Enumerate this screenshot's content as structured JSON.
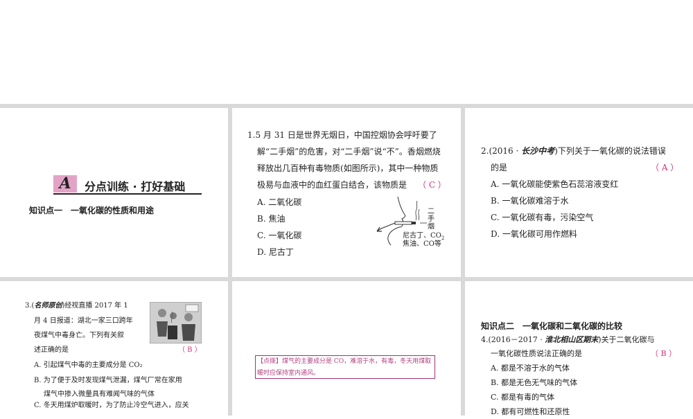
{
  "section": {
    "badge": "A",
    "title": "分点训练 · 打好基础",
    "kp1": "知识点一　一氧化碳的性质和用途",
    "kp2": "知识点二　一氧化碳和二氧化碳的比较"
  },
  "q1": {
    "lines": [
      "1.5 月 31 日是世界无烟日，中国控烟协会呼吁要了",
      "解“二手烟”的危害，对“二手烟”说“不”。香烟燃烧",
      "释放出几百种有毒物质(如图所示)，其中一种物质",
      "极易与血液中的血红蛋白结合，该物质是"
    ],
    "answer": "（ C ）",
    "options": [
      "A. 二氧化碳",
      "B. 焦油",
      "C. 一氧化碳",
      "D. 尼古丁"
    ],
    "figure_labels": {
      "vertical": [
        "二",
        "手",
        "烟"
      ],
      "line1": "尼古丁、CO",
      "sub": "2",
      "line2": "焦油、CO等"
    }
  },
  "q2": {
    "stem_prefix": "2.(2016 · ",
    "source": "长沙中考",
    "stem_suffix": ")下列关于一氧化碳的说法错误",
    "line2": "的是",
    "answer": "（ A ）",
    "options": [
      "A. 一氧化碳能使紫色石蕊溶液变红",
      "B. 一氧化碳难溶于水",
      "C. 一氧化碳有毒，污染空气",
      "D. 一氧化碳可用作燃料"
    ]
  },
  "q3": {
    "prefix": "3.(",
    "source": "名师原创",
    "lines": [
      ")经视直播 2017 年 1",
      "月 4 日报道：湖北一家三口跨年",
      "夜煤气中毒身亡。下列有关叙",
      "述正确的是"
    ],
    "answer": "（ B ）",
    "options": [
      "A. 引起煤气中毒的主要成分是 CO₂",
      "B. 为了便于及时发现煤气泄漏，煤气厂常在家用",
      "煤气中掺入微量具有难闻气味的气体",
      "C. 冬天用煤炉取暖时，为了防止冷空气进入，应关"
    ]
  },
  "tip": {
    "label": "【点拨】",
    "text": "煤气的主要成分是 CO，难溶于水，有毒，冬天用煤取暖时应保持室内通风。"
  },
  "q4": {
    "stem_prefix": "4.(2016－2017 · ",
    "source": "淮北相山区期末",
    "stem_suffix": ")关于二氧化碳与",
    "line2": "一氧化碳性质说法正确的是",
    "answer": "（ B ）",
    "options": [
      "A. 都是不溶于水的气体",
      "B. 都是无色无气味的气体",
      "C. 都是有毒的气体",
      "D. 都有可燃性和还原性"
    ]
  }
}
